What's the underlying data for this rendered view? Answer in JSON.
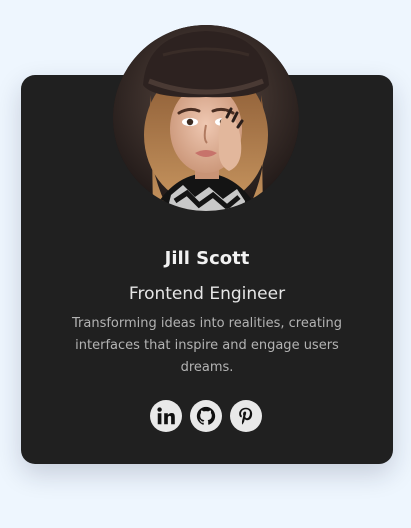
{
  "profile": {
    "name": "Jill Scott",
    "role": "Frontend Engineer",
    "bio": "Transforming ideas into realities, creating interfaces that inspire and engage users dreams."
  },
  "social": [
    {
      "icon": "linkedin-icon"
    },
    {
      "icon": "github-icon"
    },
    {
      "icon": "pinterest-icon"
    }
  ],
  "colors": {
    "page_background": "#eef6fe",
    "card_background": "#202020",
    "icon_background": "#e9e9e9",
    "icon_foreground": "#111111"
  }
}
